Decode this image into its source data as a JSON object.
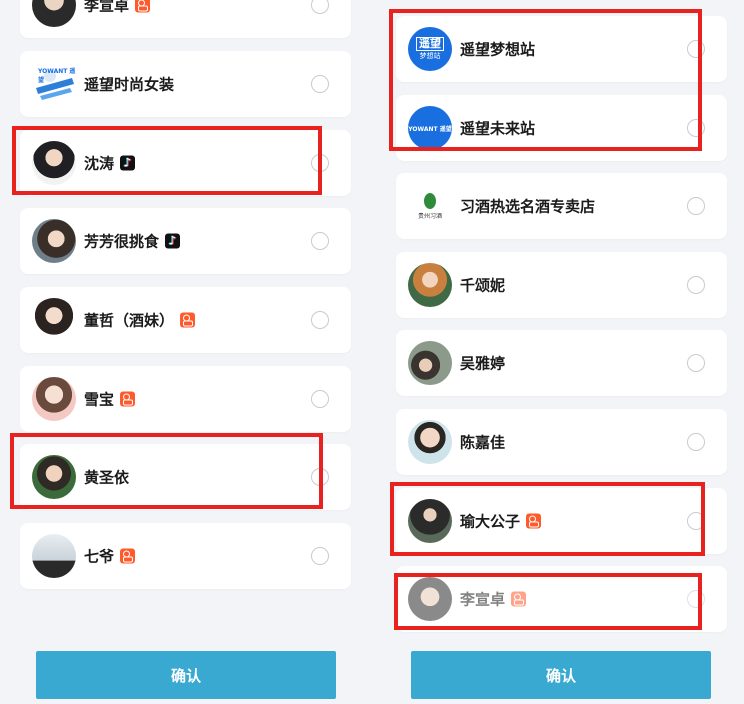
{
  "left_panel": {
    "items": [
      {
        "name": "李宣卓",
        "badge": "kuaishou-badge-icon"
      },
      {
        "name": "遥望时尚女装",
        "badge": ""
      },
      {
        "name": "沈涛",
        "badge": "douyin-badge-icon"
      },
      {
        "name": "芳芳很挑食",
        "badge": "douyin-badge-icon"
      },
      {
        "name": "董哲（酒妹）",
        "badge": "kuaishou-badge-icon"
      },
      {
        "name": "雪宝",
        "badge": "kuaishou-badge-icon"
      },
      {
        "name": "黄圣依",
        "badge": ""
      },
      {
        "name": "七爷",
        "badge": "kuaishou-badge-icon"
      }
    ],
    "confirm_label": "确认"
  },
  "right_panel": {
    "items": [
      {
        "name": "遥望梦想站",
        "badge": "",
        "logo_text": "遥望",
        "logo_sub": "梦想站"
      },
      {
        "name": "遥望未来站",
        "badge": "",
        "logo_text": "YOWANT 遥望"
      },
      {
        "name": "习酒热选名酒专卖店",
        "badge": "",
        "logo_text": "贵州习酒"
      },
      {
        "name": "千颂妮",
        "badge": ""
      },
      {
        "name": "吴雅婷",
        "badge": ""
      },
      {
        "name": "陈嘉佳",
        "badge": ""
      },
      {
        "name": "瑜大公子",
        "badge": "kuaishou-badge-icon"
      },
      {
        "name": "李宣卓",
        "badge": "kuaishou-badge-icon"
      }
    ],
    "confirm_label": "确认"
  },
  "left_logo_text": "YOWANT 遥望",
  "colors": {
    "page_bg": "#f3f4f7",
    "card_bg": "#ffffff",
    "confirm_bg": "#3aa9d1",
    "highlight": "#e8231f",
    "kuaishou": "#ff5a2c",
    "douyin": "#111111",
    "yowant_blue": "#1a6fe0"
  }
}
